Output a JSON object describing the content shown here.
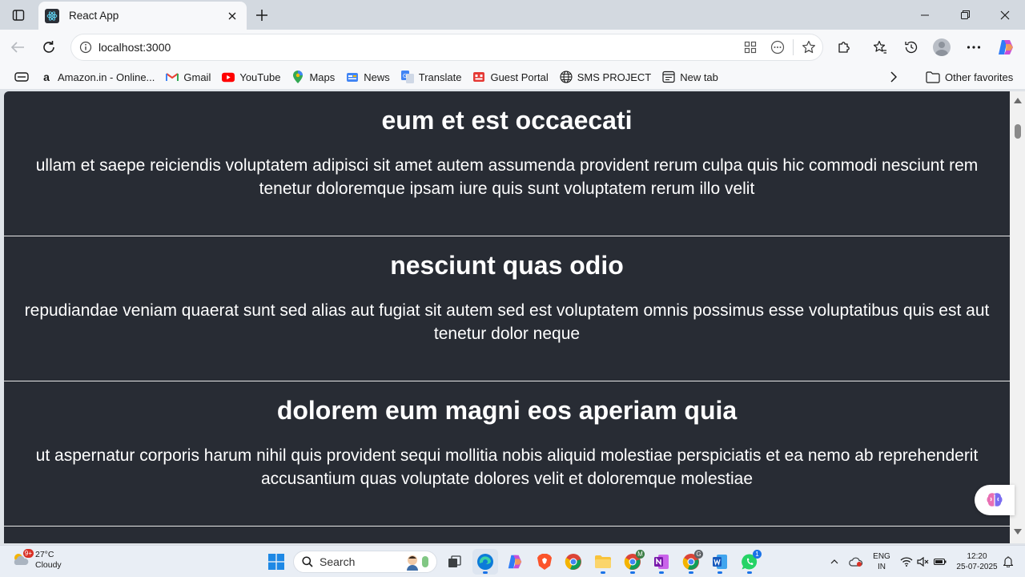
{
  "browser": {
    "tab": {
      "title": "React App"
    },
    "address": {
      "url": "localhost:3000"
    },
    "favorites": [
      {
        "label": "Amazon.in - Online...",
        "icon": "amazon-icon"
      },
      {
        "label": "Gmail",
        "icon": "gmail-icon"
      },
      {
        "label": "YouTube",
        "icon": "youtube-icon"
      },
      {
        "label": "Maps",
        "icon": "maps-icon"
      },
      {
        "label": "News",
        "icon": "news-icon"
      },
      {
        "label": "Translate",
        "icon": "translate-icon"
      },
      {
        "label": "Guest Portal",
        "icon": "portal-icon"
      },
      {
        "label": "SMS PROJECT",
        "icon": "globe-icon"
      },
      {
        "label": "New tab",
        "icon": "newtab-icon"
      }
    ],
    "other_favorites": "Other favorites"
  },
  "page": {
    "background": "#282c34",
    "posts": [
      {
        "title": "eum et est occaecati",
        "body": "ullam et saepe reiciendis voluptatem adipisci sit amet autem assumenda provident rerum culpa quis hic commodi nesciunt rem tenetur doloremque ipsam iure quis sunt voluptatem rerum illo velit"
      },
      {
        "title": "nesciunt quas odio",
        "body": "repudiandae veniam quaerat sunt sed alias aut fugiat sit autem sed est voluptatem omnis possimus esse voluptatibus quis est aut tenetur dolor neque"
      },
      {
        "title": "dolorem eum magni eos aperiam quia",
        "body": "ut aspernatur corporis harum nihil quis provident sequi mollitia nobis aliquid molestiae perspiciatis et ea nemo ab reprehenderit accusantium quas voluptate dolores velit et doloremque molestiae"
      }
    ]
  },
  "taskbar": {
    "weather": {
      "temp": "27°C",
      "condition": "Cloudy",
      "badge": "9+"
    },
    "search_label": "Search",
    "language": {
      "line1": "ENG",
      "line2": "IN"
    },
    "clock": {
      "time": "12:20",
      "date": "25-07-2025"
    },
    "badges": {
      "chrome_profile": "M",
      "chrome_profile2": "G",
      "whatsapp": "1"
    }
  }
}
